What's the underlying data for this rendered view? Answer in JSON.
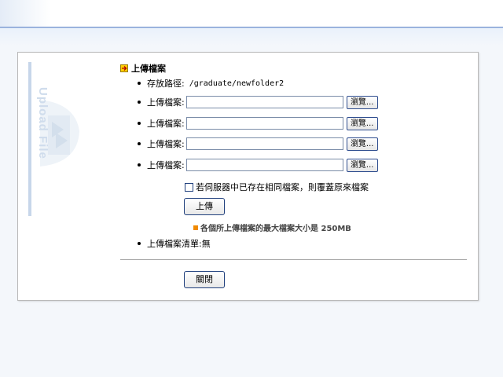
{
  "side_label": "Upload File",
  "title": "上傳檔案",
  "path_row": {
    "label": "存放路徑:",
    "value": "/graduate/newfolder2"
  },
  "upload_rows": [
    {
      "label": "上傳檔案:",
      "value": "",
      "browse": "瀏覽..."
    },
    {
      "label": "上傳檔案:",
      "value": "",
      "browse": "瀏覽..."
    },
    {
      "label": "上傳檔案:",
      "value": "",
      "browse": "瀏覽..."
    },
    {
      "label": "上傳檔案:",
      "value": "",
      "browse": "瀏覽..."
    }
  ],
  "overwrite_checkbox": {
    "label": "若伺服器中已存在相同檔案，則覆蓋原來檔案",
    "checked": false
  },
  "upload_button": "上傳",
  "size_note": "各個所上傳檔案的最大檔案大小是 250MB",
  "file_list": {
    "label": "上傳檔案清單:",
    "value": "無"
  },
  "close_button": "關閉",
  "colors": {
    "accent": "#6e8fcc",
    "note_square": "#f08a00",
    "title_icon": "#ffd000"
  }
}
